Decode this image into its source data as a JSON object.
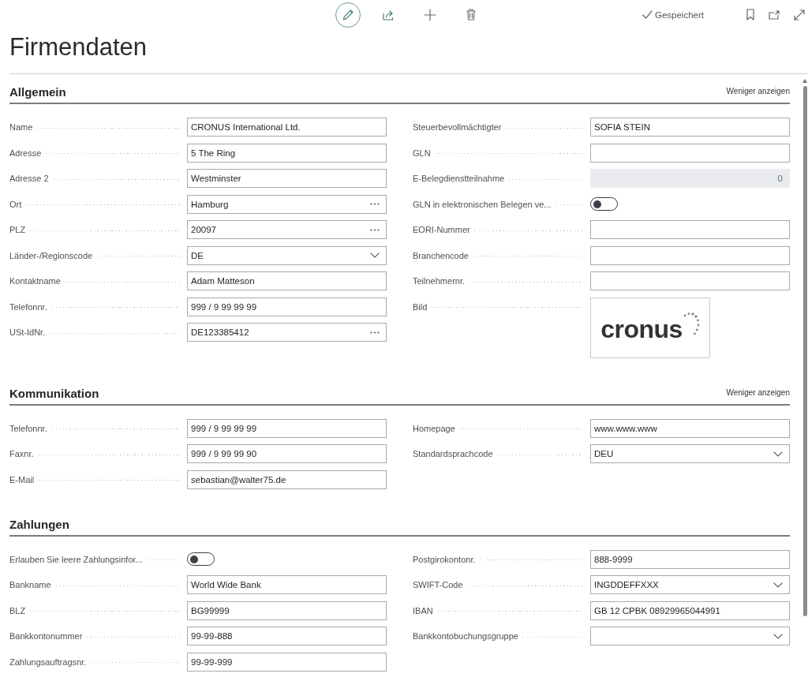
{
  "toolbar": {
    "actions": [
      {
        "kind": "edit",
        "selected": true
      },
      {
        "kind": "share",
        "selected": false
      },
      {
        "kind": "add",
        "selected": false
      },
      {
        "kind": "delete",
        "selected": false
      }
    ],
    "status": "Gespeichert",
    "window_actions": [
      {
        "kind": "bookmark"
      },
      {
        "kind": "popout"
      },
      {
        "kind": "expand"
      }
    ]
  },
  "page_title": "Firmendaten",
  "sections": [
    {
      "title": "Allgemein",
      "toggle_link": "Weniger anzeigen",
      "columns": [
        {
          "fields": [
            {
              "label": "Name",
              "kind": "text",
              "value": "CRONUS International Ltd."
            },
            {
              "label": "Adresse",
              "kind": "text",
              "value": "5 The Ring"
            },
            {
              "label": "Adresse 2",
              "kind": "text",
              "value": "Westminster"
            },
            {
              "label": "Ort",
              "kind": "lookup",
              "value": "Hamburg"
            },
            {
              "label": "PLZ",
              "kind": "lookup",
              "value": "20097"
            },
            {
              "label": "Länder-/Regionscode",
              "kind": "dropdown",
              "value": "DE"
            },
            {
              "label": "Kontaktname",
              "kind": "text",
              "value": "Adam Matteson"
            },
            {
              "label": "Telefonnr.",
              "kind": "text",
              "value": "999 / 9 99 99 99"
            },
            {
              "label": "USt-IdNr.",
              "kind": "lookup",
              "value": "DE123385412"
            }
          ]
        },
        {
          "fields": [
            {
              "label": "Steuerbevollmächtigter",
              "kind": "text",
              "value": "SOFIA STEIN"
            },
            {
              "label": "GLN",
              "kind": "text"
            },
            {
              "label": "E-Belegdienstteilnahme",
              "kind": "readonly",
              "value": "0"
            },
            {
              "label": "GLN in elektronischen Belegen ve...",
              "kind": "toggle",
              "on": false
            },
            {
              "label": "EORI-Nummer",
              "kind": "text"
            },
            {
              "label": "Branchencode",
              "kind": "text"
            },
            {
              "label": "Teilnehmernr.",
              "kind": "text"
            },
            {
              "label": "Bild",
              "kind": "picture",
              "logo_text": "cronus"
            }
          ]
        }
      ]
    },
    {
      "title": "Kommunikation",
      "toggle_link": "Weniger anzeigen",
      "columns": [
        {
          "fields": [
            {
              "label": "Telefonnr.",
              "kind": "text",
              "value": "999 / 9 99 99 99"
            },
            {
              "label": "Faxnr.",
              "kind": "text",
              "value": "999 / 9 99 99 90"
            },
            {
              "label": "E-Mail",
              "kind": "text",
              "value": "sebastian@walter75.de"
            }
          ]
        },
        {
          "fields": [
            {
              "label": "Homepage",
              "kind": "text",
              "value": "www.www.www"
            },
            {
              "label": "Standardsprachcode",
              "kind": "dropdown",
              "value": "DEU"
            }
          ]
        }
      ]
    },
    {
      "title": "Zahlungen",
      "columns": [
        {
          "fields": [
            {
              "label": "Erlauben Sie leere Zahlungsinfor...",
              "kind": "toggle",
              "on": false
            },
            {
              "label": "Bankname",
              "kind": "text",
              "value": "World Wide Bank"
            },
            {
              "label": "BLZ",
              "kind": "text",
              "value": "BG99999"
            },
            {
              "label": "Bankkontonummer",
              "kind": "text",
              "value": "99-99-888"
            },
            {
              "label": "Zahlungsauftragsnr.",
              "kind": "text",
              "value": "99-99-999"
            }
          ]
        },
        {
          "fields": [
            {
              "label": "Postgirokontonr.",
              "kind": "text",
              "value": "888-9999"
            },
            {
              "label": "SWIFT-Code",
              "kind": "dropdown",
              "value": "INGDDEFFXXX"
            },
            {
              "label": "IBAN",
              "kind": "text",
              "value": "GB 12 CPBK 08929965044991"
            },
            {
              "label": "Bankkontobuchungsgruppe",
              "kind": "dropdown"
            }
          ]
        }
      ]
    }
  ]
}
